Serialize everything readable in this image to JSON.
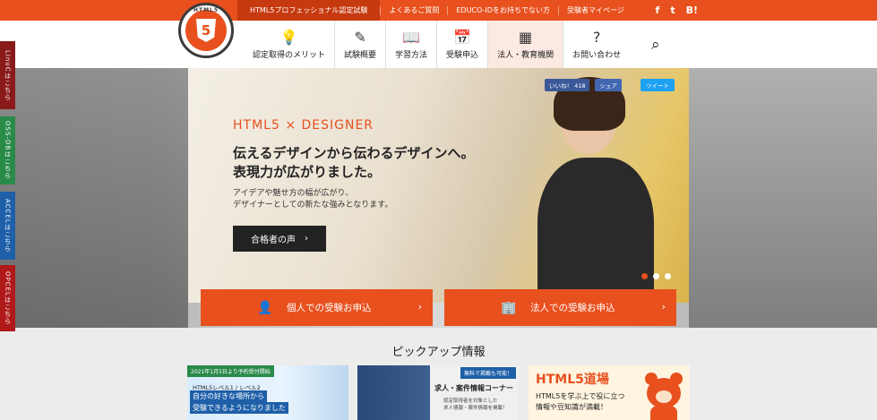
{
  "topbar": {
    "links": [
      "HTML5プロフェッショナル認定試験",
      "よくあるご質問",
      "EDUCO-IDをお持ちでない方",
      "受験者マイページ"
    ],
    "social": [
      "f",
      "t",
      "B!"
    ]
  },
  "logo": {
    "ring_text": "HTML5",
    "mark": "5"
  },
  "nav": {
    "items": [
      {
        "icon": "💡",
        "label": "認定取得のメリット"
      },
      {
        "icon": "✎",
        "label": "試験概要"
      },
      {
        "icon": "📖",
        "label": "学習方法"
      },
      {
        "icon": "📅",
        "label": "受験申込"
      },
      {
        "icon": "▦",
        "label": "法人・教育機関"
      },
      {
        "icon": "?",
        "label": "お問い合わせ"
      }
    ],
    "search_icon": "⌕"
  },
  "side_tabs": [
    {
      "label": "LinuCはこちら",
      "color": "#8b1a1a"
    },
    {
      "label": "OSS-DBはこちら",
      "color": "#2a8a4a"
    },
    {
      "label": "ACCELはこちら",
      "color": "#1e5fa8"
    },
    {
      "label": "OPCELはこちら",
      "color": "#b01a1a"
    }
  ],
  "hero": {
    "eyebrow": "HTML5 × DESIGNER",
    "headline_1": "伝えるデザインから伝わるデザインへ。",
    "headline_2": "表現力が広がりました。",
    "sub_1": "アイデアや魅せ方の幅が広がり、",
    "sub_2": "デザイナーとしての新たな強みとなります。",
    "button": "合格者の声",
    "button_arrow": "›",
    "fb_like": "いいね！ 418",
    "fb_share": "シェア",
    "tweet": "ツイート"
  },
  "cta": {
    "personal": "個人での受験お申込",
    "corporate": "法人での受験お申込",
    "arrow": "›"
  },
  "pickup": {
    "title": "ピックアップ情報",
    "card1": {
      "tag": "2021年1月5日より予約受付開始",
      "line1": "HTML5レベル1 / レベル2",
      "line2": "自分の好きな場所から",
      "line3": "受験できるようになりました"
    },
    "card2": {
      "tag": "無料で掲載も可能！",
      "title": "求人・案件情報コーナー",
      "desc1": "認定取得者を対象とした",
      "desc2": "求人情報・案件情報を掲載！"
    },
    "card3": {
      "title": "HTML5道場",
      "line1": "HTML5を学ぶ上で役に立つ",
      "line2": "情報や豆知識が満載！"
    }
  }
}
